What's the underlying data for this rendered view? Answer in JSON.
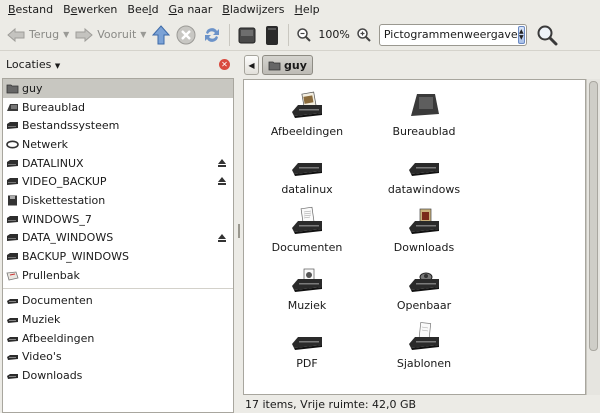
{
  "menubar": {
    "items": [
      {
        "pre": "",
        "u": "B",
        "post": "estand"
      },
      {
        "pre": "B",
        "u": "e",
        "post": "werken"
      },
      {
        "pre": "Bee",
        "u": "l",
        "post": "d"
      },
      {
        "pre": "",
        "u": "G",
        "post": "a naar"
      },
      {
        "pre": "",
        "u": "B",
        "post": "ladwijzers"
      },
      {
        "pre": "",
        "u": "H",
        "post": "elp"
      }
    ]
  },
  "toolbar": {
    "back_label": "Terug",
    "forward_label": "Vooruit",
    "zoom_level": "100%",
    "view_mode": "Pictogrammenweergave"
  },
  "sidebar": {
    "header": "Locaties",
    "devices": [
      {
        "label": "guy",
        "icon": "home-folder-icon",
        "selected": true
      },
      {
        "label": "Bureaublad",
        "icon": "desktop-icon"
      },
      {
        "label": "Bestandssysteem",
        "icon": "drive-icon"
      },
      {
        "label": "Netwerk",
        "icon": "network-icon"
      },
      {
        "label": "DATALINUX",
        "icon": "drive-icon",
        "eject": true
      },
      {
        "label": "VIDEO_BACKUP",
        "icon": "drive-icon",
        "eject": true
      },
      {
        "label": "Diskettestation",
        "icon": "floppy-icon"
      },
      {
        "label": "WINDOWS_7",
        "icon": "drive-icon"
      },
      {
        "label": "DATA_WINDOWS",
        "icon": "drive-icon",
        "eject": true
      },
      {
        "label": "BACKUP_WINDOWS",
        "icon": "drive-icon"
      },
      {
        "label": "Prullenbak",
        "icon": "trash-icon"
      }
    ],
    "bookmarks": [
      {
        "label": "Documenten",
        "icon": "folder-icon"
      },
      {
        "label": "Muziek",
        "icon": "folder-icon"
      },
      {
        "label": "Afbeeldingen",
        "icon": "folder-icon"
      },
      {
        "label": "Video's",
        "icon": "folder-icon"
      },
      {
        "label": "Downloads",
        "icon": "folder-icon"
      }
    ]
  },
  "pathbar": {
    "current": "guy"
  },
  "files": [
    {
      "label": "Afbeeldingen",
      "icon": "pictures-folder-icon"
    },
    {
      "label": "Bureaublad",
      "icon": "desktop-folder-icon"
    },
    {
      "label": "datalinux",
      "icon": "folder-icon"
    },
    {
      "label": "datawindows",
      "icon": "folder-icon"
    },
    {
      "label": "Documenten",
      "icon": "documents-folder-icon"
    },
    {
      "label": "Downloads",
      "icon": "downloads-folder-icon"
    },
    {
      "label": "Muziek",
      "icon": "music-folder-icon"
    },
    {
      "label": "Openbaar",
      "icon": "public-folder-icon"
    },
    {
      "label": "PDF",
      "icon": "folder-icon"
    },
    {
      "label": "Sjablonen",
      "icon": "templates-folder-icon"
    },
    {
      "label": "",
      "icon": "folder-icon"
    },
    {
      "label": "",
      "icon": "folder-icon"
    }
  ],
  "status": "17 items, Vrije ruimte: 42,0 GB"
}
